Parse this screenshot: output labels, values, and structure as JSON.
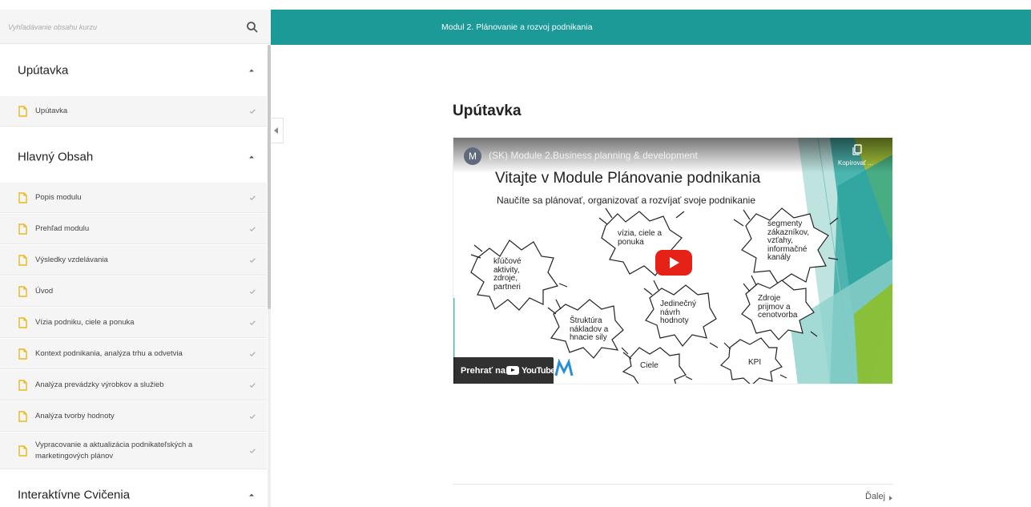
{
  "search": {
    "placeholder": "Vyhľadávanie obsahu kurzu",
    "icon": "search-icon"
  },
  "header": {
    "module_title": "Modul 2. Plánovanie a rozvoj podnikania",
    "color": "#1b9a98"
  },
  "sidebar": {
    "sections": [
      {
        "title": "Upútavka",
        "items": [
          {
            "label": "Upútavka"
          }
        ]
      },
      {
        "title": "Hlavný Obsah",
        "items": [
          {
            "label": "Popis modulu"
          },
          {
            "label": "Prehľad modulu"
          },
          {
            "label": "Výsledky vzdelávania"
          },
          {
            "label": "Úvod"
          },
          {
            "label": "Vízia podniku, ciele a ponuka"
          },
          {
            "label": "Kontext podnikania, analýza trhu a odvetvia"
          },
          {
            "label": "Analýza prevádzky výrobkov a služieb"
          },
          {
            "label": "Analýza tvorby hodnoty"
          },
          {
            "label": "Vypracovanie a aktualizácia podnikateľských a marketingových plánov"
          }
        ]
      },
      {
        "title": "Interaktívne Cvičenia",
        "items": []
      }
    ]
  },
  "content": {
    "title": "Upútavka"
  },
  "video": {
    "avatar_letter": "M",
    "title": "(SK) Module 2.Business planning & development",
    "copy_label": "Kopírovať ...",
    "headline": "Vitajte v Module Plánovanie podnikania",
    "subheadline": "Naučíte sa plánovať, organizovať a rozvíjať svoje podnikanie",
    "bubbles": {
      "b1": "kľúčové\naktivity,\nzdroje,\npartneri",
      "b2": "vízia, ciele a\nponuka",
      "b3": "segmenty\nzákazníkov,\nvzťahy,\ninformačné\nkanály",
      "b4": "Štruktúra\nnákladov a\nhnacie sily",
      "b5": "Jedinečný\nnávrh\nhodnoty",
      "b6": "Zdroje\nprijmov a\ncenotvorba",
      "b7": "Ciele",
      "b8": "KPI"
    },
    "watch_on": "Prehrať na",
    "youtube": "YouTube"
  },
  "nav": {
    "next_label": "Ďalej"
  }
}
